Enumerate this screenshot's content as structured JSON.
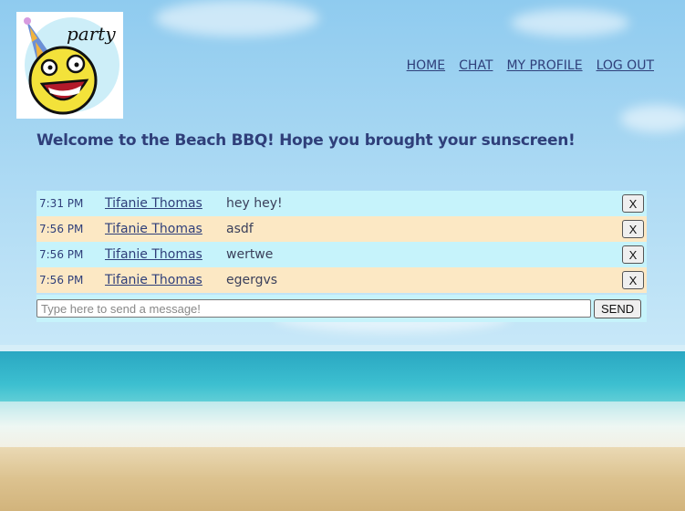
{
  "logo": {
    "text": "party",
    "icon": "party-smiley-icon"
  },
  "nav": {
    "home": "HOME",
    "chat": "CHAT",
    "profile": "MY PROFILE",
    "logout": "LOG OUT"
  },
  "welcome": "Welcome to the Beach BBQ! Hope you brought your sunscreen!",
  "messages": [
    {
      "time": "7:31 PM",
      "user": "Tifanie Thomas",
      "text": "hey hey!",
      "delete": "X"
    },
    {
      "time": "7:56 PM",
      "user": "Tifanie Thomas",
      "text": "asdf",
      "delete": "X"
    },
    {
      "time": "7:56 PM",
      "user": "Tifanie Thomas",
      "text": "wertwe",
      "delete": "X"
    },
    {
      "time": "7:56 PM",
      "user": "Tifanie Thomas",
      "text": "egergvs",
      "delete": "X"
    }
  ],
  "composer": {
    "placeholder": "Type here to send a message!",
    "value": "",
    "send": "SEND"
  },
  "colors": {
    "text": "#2f3f7a",
    "row_even": "#c6f3fb",
    "row_odd": "#fce8c4"
  }
}
